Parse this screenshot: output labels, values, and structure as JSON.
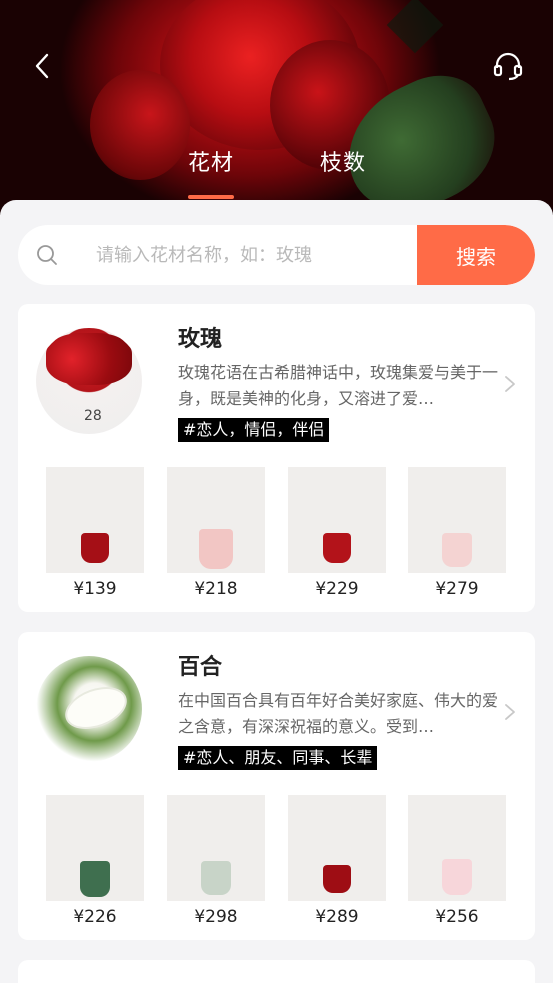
{
  "header": {
    "tabs": [
      {
        "label": "花材"
      },
      {
        "label": "枝数"
      }
    ],
    "active_tab": "花材"
  },
  "search": {
    "placeholder": "请输入花材名称，如：玫瑰",
    "button_label": "搜索"
  },
  "colors": {
    "accent": "#ff6b47"
  },
  "flowers": [
    {
      "name": "玫瑰",
      "description": "玫瑰花语在古希腊神话中，玫瑰集爱与美于一身，既是美神的化身，又溶进了爱…",
      "tag": "#恋人，情侣，伴侣",
      "products": [
        {
          "price": "¥139"
        },
        {
          "price": "¥218"
        },
        {
          "price": "¥229"
        },
        {
          "price": "¥279"
        }
      ]
    },
    {
      "name": "百合",
      "description": "在中国百合具有百年好合美好家庭、伟大的爱之含意，有深深祝福的意义。受到…",
      "tag": "#恋人、朋友、同事、长辈",
      "products": [
        {
          "price": "¥226"
        },
        {
          "price": "¥298"
        },
        {
          "price": "¥289"
        },
        {
          "price": "¥256"
        }
      ]
    }
  ],
  "icons": {
    "back": "chevron-left-icon",
    "support": "headset-icon",
    "search": "search-icon",
    "more": "chevron-right-icon"
  }
}
